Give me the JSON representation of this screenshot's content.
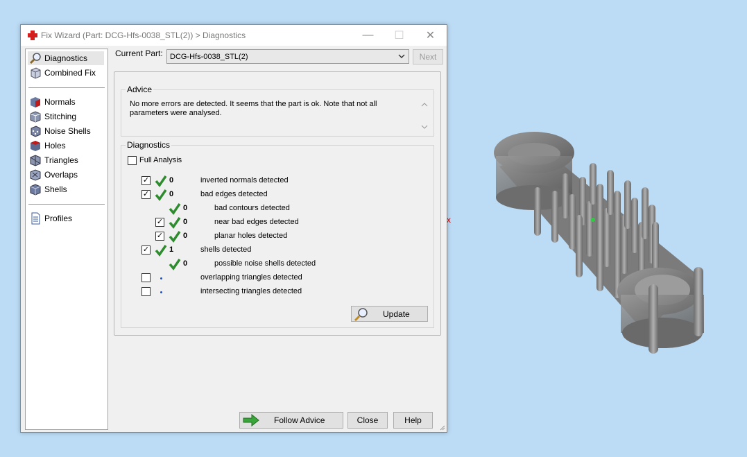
{
  "window": {
    "title": "Fix Wizard (Part: DCG-Hfs-0038_STL(2)) > Diagnostics",
    "minimize_glyph": "—",
    "maximize_glyph": "☐",
    "close_glyph": "✕"
  },
  "nav": {
    "items": [
      {
        "label": "Diagnostics",
        "icon": "magnifier-icon"
      },
      {
        "label": "Combined Fix",
        "icon": "cube-icon"
      },
      {
        "label": "Normals",
        "icon": "normals-icon"
      },
      {
        "label": "Stitching",
        "icon": "stitching-icon"
      },
      {
        "label": "Noise Shells",
        "icon": "noise-shells-icon"
      },
      {
        "label": "Holes",
        "icon": "holes-icon"
      },
      {
        "label": "Triangles",
        "icon": "triangles-icon"
      },
      {
        "label": "Overlaps",
        "icon": "overlaps-icon"
      },
      {
        "label": "Shells",
        "icon": "shells-icon"
      },
      {
        "label": "Profiles",
        "icon": "document-icon"
      }
    ]
  },
  "current_part": {
    "label": "Current Part:",
    "value": "DCG-Hfs-0038_STL(2)",
    "next_label": "Next"
  },
  "advice": {
    "title": "Advice",
    "text": "No more errors are detected. It seems that the part is ok. Note that not all parameters were analysed."
  },
  "diagnostics": {
    "title": "Diagnostics",
    "full_analysis_label": "Full Analysis",
    "rows": [
      {
        "count": "0",
        "label": "inverted normals detected"
      },
      {
        "count": "0",
        "label": "bad edges detected"
      },
      {
        "count": "0",
        "label": "bad contours detected"
      },
      {
        "count": "0",
        "label": "near bad edges detected"
      },
      {
        "count": "0",
        "label": "planar holes detected"
      },
      {
        "count": "1",
        "label": "shells detected"
      },
      {
        "count": "0",
        "label": "possible noise shells detected"
      },
      {
        "count": "",
        "label": "overlapping triangles detected"
      },
      {
        "count": "",
        "label": "intersecting triangles detected"
      }
    ],
    "update_label": "Update"
  },
  "footer": {
    "follow_advice_label": "Follow Advice",
    "close_label": "Close",
    "help_label": "Help"
  },
  "viewport": {
    "axis_marker": "x"
  },
  "colors": {
    "check_green": "#2e8b2e",
    "background": "#bcdcf6"
  }
}
